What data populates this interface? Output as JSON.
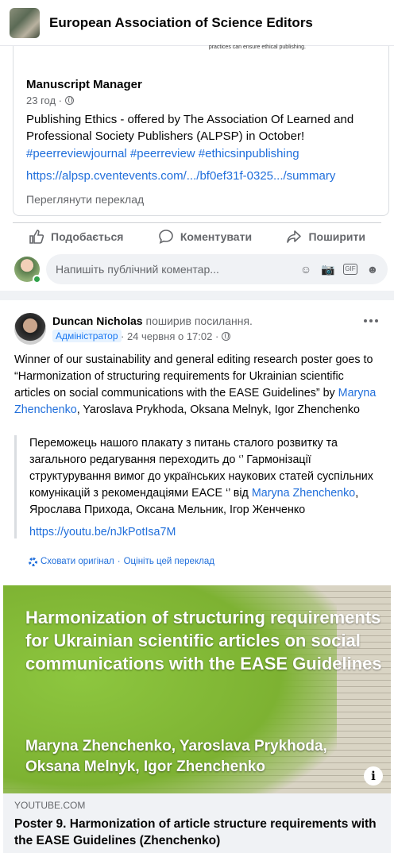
{
  "header": {
    "group_name": "European Association of Science Editors"
  },
  "post1": {
    "cut_text": "practices can ensure ethical publishing.",
    "shared_author": "Manuscript Manager",
    "shared_time": "23 год ·",
    "shared_text": "Publishing Ethics - offered by The Association Of Learned and Professional Society Publishers (ALPSP) in October!",
    "hashtags": "#peerreviewjournal #peerreview #ethicsinpublishing",
    "link": "https://alpsp.cventevents.com/.../bf0ef31f-0325.../summary",
    "see_translation": "Переглянути переклад",
    "actions": {
      "like": "Подобається",
      "comment": "Коментувати",
      "share": "Поширити"
    },
    "comment_placeholder": "Напишіть публічний коментар..."
  },
  "post2": {
    "author": "Duncan Nicholas",
    "action": " поширив посилання.",
    "badge": "Адміністратор",
    "date": "· 24 червня о 17:02 ·",
    "text_1": "Winner of our sustainability and general editing research poster goes to “Harmonization of structuring requirements for Ukrainian scientific articles on social communications with the EASE Guidelines” by ",
    "text_link": "Maryna Zhenchenko",
    "text_2": ", Yaroslava Prykhoda, Oksana Melnyk, Igor Zhenchenko",
    "quote_1": "Переможець нашого плакату з питань сталого розвитку та загального редагування переходить до ‘’ Гармонізації структурування вимог до українських наукових статей суспільних комунікацій з рекомендаціями EACE ‘’ від ",
    "quote_link": "Maryna Zhenchenko",
    "quote_2": ", Ярослава Прихода, Оксана Мельник, Ігор Женченко",
    "quote_url": "https://youtu.be/nJkPotIsa7M",
    "hide_original": "Сховати оригінал",
    "rate_translation": "Оцініть цей переклад",
    "thumb_title": "Harmonization of structuring requirements for Ukrainian scientific articles on social communications with the EASE Guidelines",
    "thumb_authors": "Maryna Zhenchenko, Yaroslava Prykhoda, Oksana Melnyk, Igor Zhenchenko",
    "preview_domain": "YOUTUBE.COM",
    "preview_title": "Poster 9. Harmonization of article structure requirements with the EASE Guidelines (Zhenchenko)"
  }
}
